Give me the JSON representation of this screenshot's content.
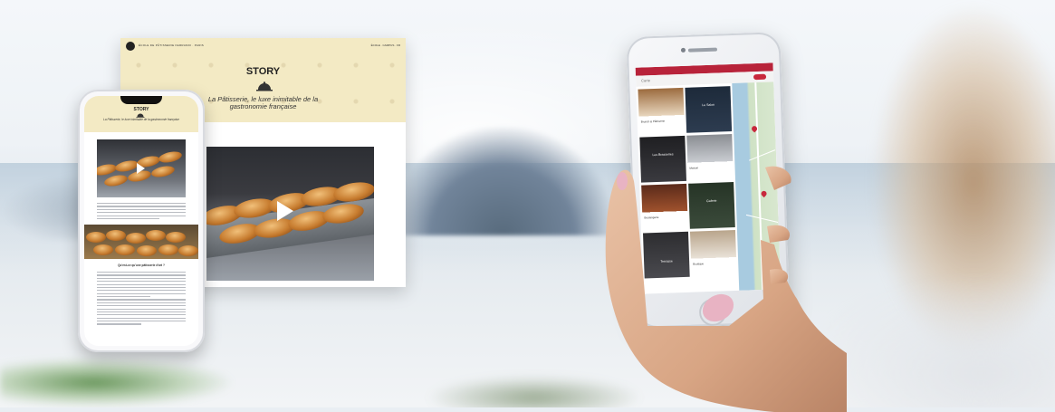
{
  "desktop": {
    "nav_left": "ÉCOLE DE PÂTISSERIE FERRANDI · PARIS",
    "nav_right": "ÉCOLE · CAMPUS · FR",
    "title": "STORY",
    "subtitle": "La Pâtisserie, le luxe inimitable de la gastronomie française"
  },
  "phone_small": {
    "title": "STORY",
    "subtitle": "La Pâtisserie, le luxe inimitable de la gastronomie française",
    "section_heading": "Qu'est-ce qu'une pâtisserie d'art ?"
  },
  "phone_big": {
    "tool_label": "Carte",
    "cards": [
      {
        "label": "Brunch & Pâtisserie"
      },
      {
        "label": "Le Salon"
      },
      {
        "label": "Les Brasseries"
      },
      {
        "label": "Maison"
      },
      {
        "label": "Boulangerie"
      },
      {
        "label": "Galerie"
      },
      {
        "label": "Terrasse"
      },
      {
        "label": "Boutique"
      }
    ]
  },
  "colors": {
    "hero_cream": "#f3eac4",
    "brand_red": "#b8233a",
    "map_water": "#a8cbe0"
  }
}
